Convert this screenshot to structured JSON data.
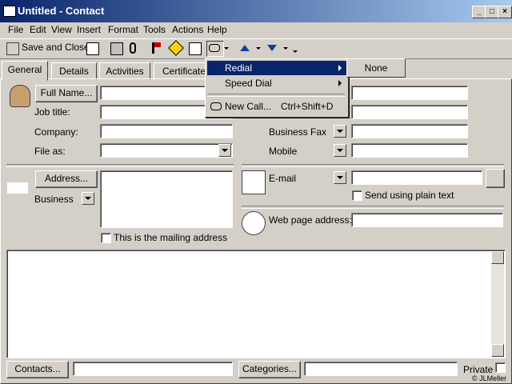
{
  "window": {
    "title": "Untitled - Contact",
    "min_glyph": "_",
    "max_glyph": "□",
    "close_glyph": "×"
  },
  "menu": [
    "File",
    "Edit",
    "View",
    "Insert",
    "Format",
    "Tools",
    "Actions",
    "Help"
  ],
  "toolbar": {
    "save_close_label": "Save and Close"
  },
  "tabs": [
    "General",
    "Details",
    "Activities",
    "Certificates"
  ],
  "fields": {
    "full_name_button": "Full Name...",
    "job_title": "Job title:",
    "company": "Company:",
    "file_as": "File as:",
    "business_fax": "Business Fax",
    "mobile": "Mobile",
    "address_button": "Address...",
    "address_type": "Business",
    "mailing_address": "This is the mailing address",
    "email": "E-mail",
    "plain_text": "Send using plain text",
    "web_page": "Web page address:"
  },
  "bottom": {
    "contacts_button": "Contacts...",
    "categories_button": "Categories...",
    "private": "Private"
  },
  "context_menu": {
    "redial": "Redial",
    "speed_dial": "Speed Dial",
    "new_call": "New Call...",
    "new_call_shortcut": "Ctrl+Shift+D"
  },
  "submenu": {
    "none": "None"
  },
  "copyright": "© JLMeller"
}
